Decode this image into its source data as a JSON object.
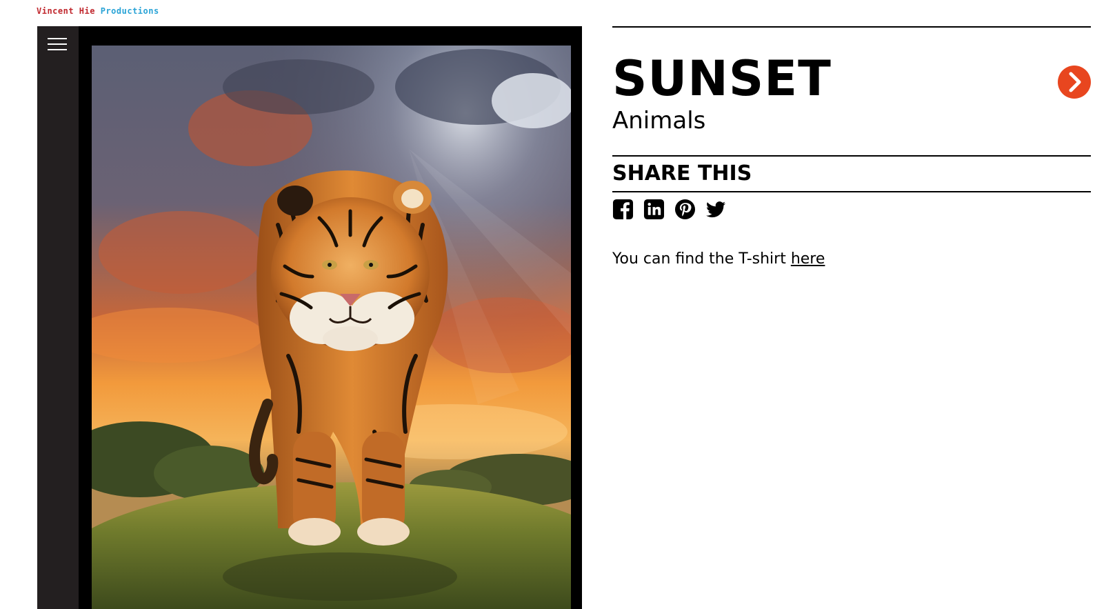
{
  "brand": {
    "name": "Vincent Hie",
    "suffix": "Productions",
    "name_color": "#c0272d",
    "suffix_color": "#29a3d6"
  },
  "viewer": {
    "menu_icon": "hamburger-menu-icon",
    "artwork_alt": "Tiger walking on a grassy hill under a sunset sky"
  },
  "detail": {
    "title": "SUNSET",
    "category": "Animals",
    "next_icon": "chevron-right-icon",
    "accent_color": "#e8461f"
  },
  "share": {
    "heading": "SHARE THIS",
    "networks": [
      "facebook-icon",
      "linkedin-icon",
      "pinterest-icon",
      "twitter-icon"
    ]
  },
  "note": {
    "text": "You can find the T-shirt ",
    "link_label": "here"
  }
}
